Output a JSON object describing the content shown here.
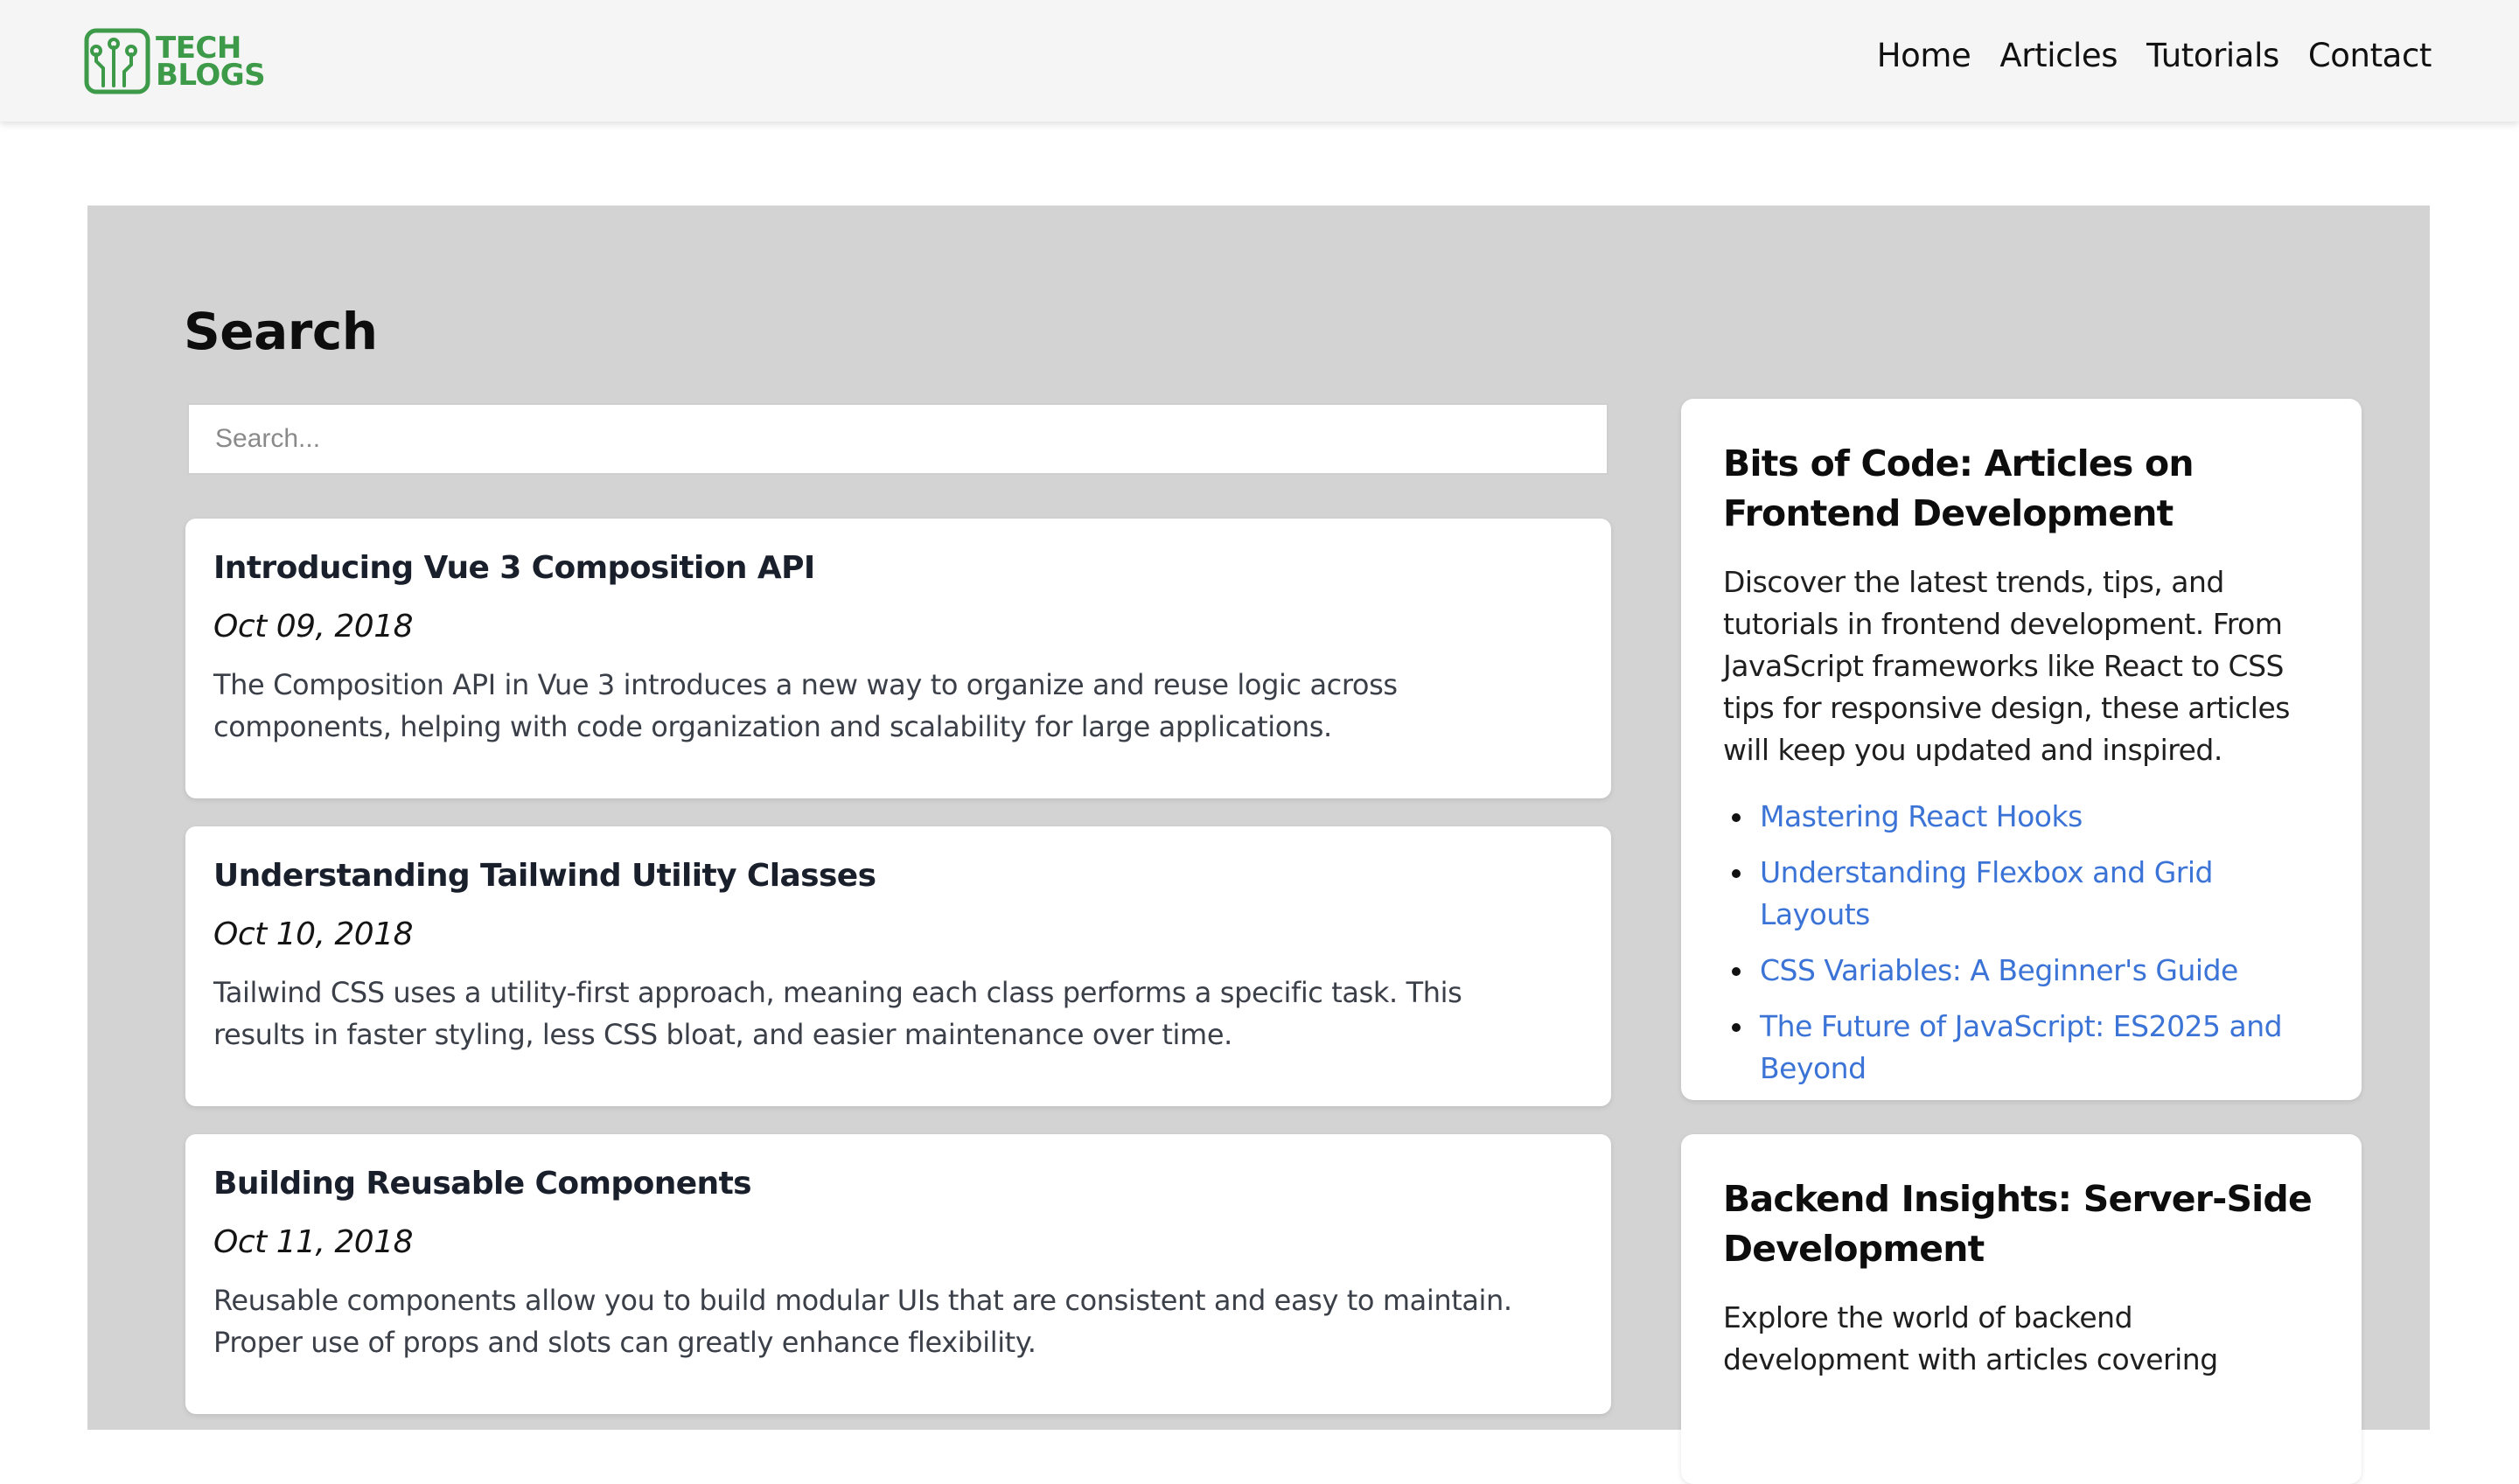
{
  "header": {
    "logo_line1": "TECH",
    "logo_line2": "BLOGS",
    "nav": [
      "Home",
      "Articles",
      "Tutorials",
      "Contact"
    ]
  },
  "search": {
    "title": "Search",
    "placeholder": "Search..."
  },
  "articles": [
    {
      "title": "Introducing Vue 3 Composition API",
      "date": "Oct 09, 2018",
      "summary": "The Composition API in Vue 3 introduces a new way to organize and reuse logic across components, helping with code organization and scalability for large applications."
    },
    {
      "title": "Understanding Tailwind Utility Classes",
      "date": "Oct 10, 2018",
      "summary": "Tailwind CSS uses a utility-first approach, meaning each class performs a specific task. This results in faster styling, less CSS bloat, and easier maintenance over time."
    },
    {
      "title": "Building Reusable Components",
      "date": "Oct 11, 2018",
      "summary": "Reusable components allow you to build modular UIs that are consistent and easy to maintain. Proper use of props and slots can greatly enhance flexibility."
    }
  ],
  "sidebar": {
    "frontend": {
      "title": "Bits of Code: Articles on Frontend Development",
      "description": "Discover the latest trends, tips, and tutorials in frontend development. From JavaScript frameworks like React to CSS tips for responsive design, these articles will keep you updated and inspired.",
      "links": [
        "Mastering React Hooks",
        "Understanding Flexbox and Grid Layouts",
        "CSS Variables: A Beginner's Guide",
        "The Future of JavaScript: ES2025 and Beyond"
      ]
    },
    "backend": {
      "title": "Backend Insights: Server-Side Development",
      "description": "Explore the world of backend development with articles covering"
    }
  },
  "colors": {
    "brand_green": "#3c9a49",
    "link_blue": "#3b74d6",
    "content_bg": "#d3d3d3",
    "header_bg": "#f5f5f5"
  },
  "icons": {
    "logo": "circuit-board-logo-icon"
  }
}
